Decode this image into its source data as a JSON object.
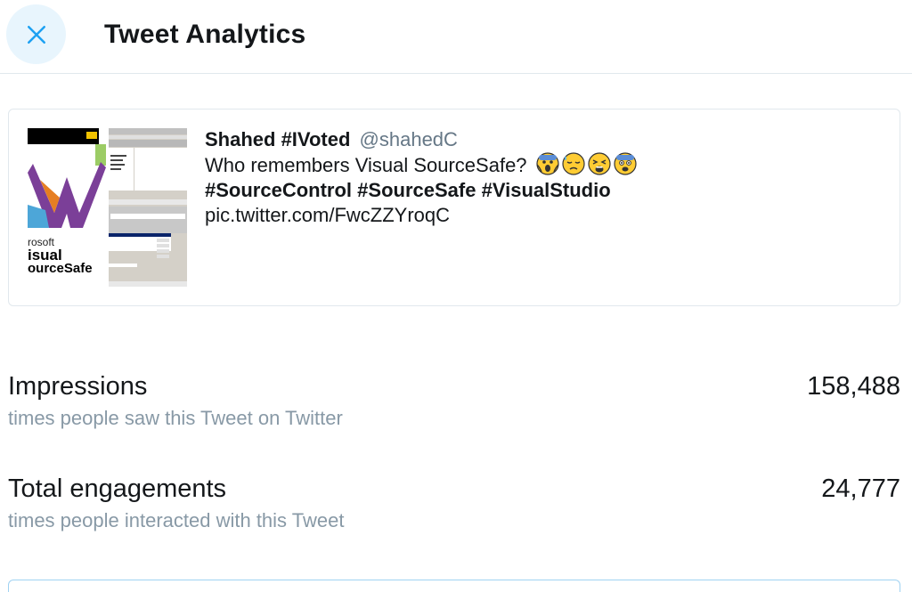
{
  "header": {
    "title": "Tweet Analytics",
    "close_icon": "close-icon"
  },
  "tweet": {
    "author_name": "Shahed #IVoted",
    "author_handle": "@shahedC",
    "text": "Who remembers Visual SourceSafe?",
    "emojis": [
      "screaming-face",
      "downcast-sweat-face",
      "weary-face",
      "fearful-face"
    ],
    "hashtags": [
      "#SourceControl",
      "#SourceSafe",
      "#VisualStudio"
    ],
    "link": "pic.twitter.com/FwcZZYroqC",
    "thumb1": {
      "product_line1": "rosoft",
      "product_line2": "isual",
      "product_line3": "ourceSafe"
    }
  },
  "metrics": [
    {
      "label": "Impressions",
      "description": "times people saw this Tweet on Twitter",
      "value": "158,488"
    },
    {
      "label": "Total engagements",
      "description": "times people interacted with this Tweet",
      "value": "24,777"
    }
  ],
  "colors": {
    "accent": "#1da1f2",
    "close_bg": "#e8f5fd",
    "border": "#e1e8ed",
    "muted_text": "#8899a6"
  }
}
